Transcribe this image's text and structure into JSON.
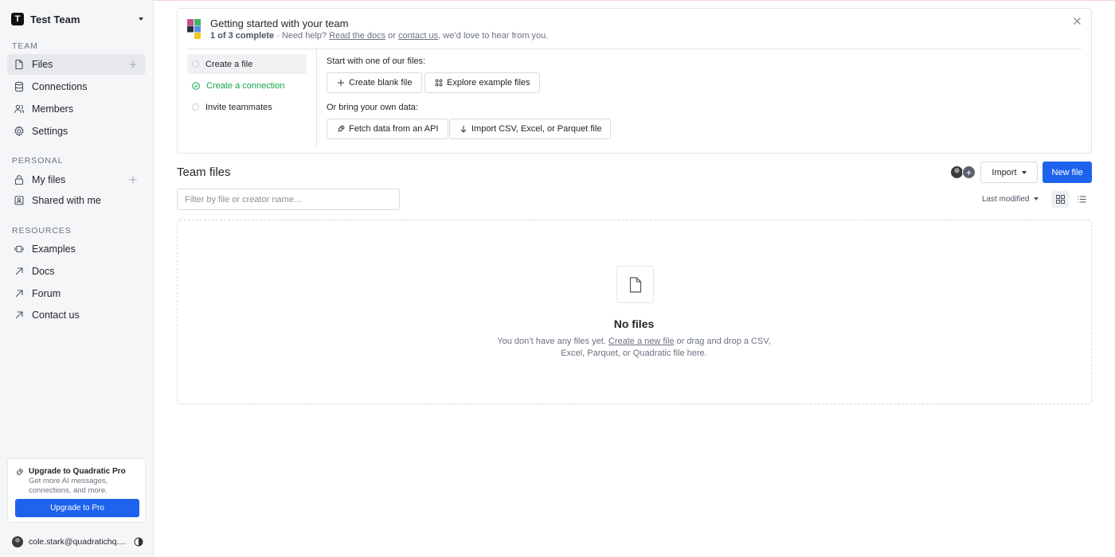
{
  "sidebar": {
    "team_name": "Test Team",
    "team_initial": "T",
    "sections": {
      "team": "TEAM",
      "personal": "PERSONAL",
      "resources": "RESOURCES"
    },
    "team_items": [
      {
        "label": "Files",
        "icon": "file-icon",
        "active": true
      },
      {
        "label": "Connections",
        "icon": "database-icon"
      },
      {
        "label": "Members",
        "icon": "users-icon"
      },
      {
        "label": "Settings",
        "icon": "gear-icon"
      }
    ],
    "personal_items": [
      {
        "label": "My files",
        "icon": "lock-icon"
      },
      {
        "label": "Shared with me",
        "icon": "shared-icon"
      }
    ],
    "resource_items": [
      {
        "label": "Examples",
        "icon": "examples-icon"
      },
      {
        "label": "Docs",
        "icon": "external-arrow-icon"
      },
      {
        "label": "Forum",
        "icon": "external-arrow-icon"
      },
      {
        "label": "Contact us",
        "icon": "external-arrow-icon"
      }
    ],
    "upgrade": {
      "title": "Upgrade to Quadratic Pro",
      "description": "Get more AI messages, connections, and more.",
      "button": "Upgrade to Pro"
    },
    "user_email": "cole.stark@quadratichq...."
  },
  "getting_started": {
    "title": "Getting started with your team",
    "progress": "1 of 3 complete",
    "help_prefix": " · Need help? ",
    "docs_link": "Read the docs",
    "or_text": " or ",
    "contact_link": "contact us",
    "help_suffix": ", we’d love to hear from you.",
    "steps": [
      {
        "label": "Create a file",
        "done": false,
        "active": true
      },
      {
        "label": "Create a connection",
        "done": true,
        "active": false
      },
      {
        "label": "Invite teammates",
        "done": false,
        "active": false
      }
    ],
    "start_heading": "Start with one of our files:",
    "create_blank": "Create blank file",
    "explore_examples": "Explore example files",
    "bring_heading": "Or bring your own data:",
    "fetch_api": "Fetch data from an API",
    "import_file": "Import CSV, Excel, or Parquet file"
  },
  "team_files": {
    "title": "Team files",
    "import_label": "Import",
    "new_file_label": "New file",
    "filter_placeholder": "Filter by file or creator name...",
    "sort_label": "Last modified",
    "empty_title": "No files",
    "empty_prefix": "You don’t have any files yet. ",
    "empty_link": "Create a new file",
    "empty_suffix": " or drag and drop a CSV, Excel, Parquet, or Quadratic file here."
  },
  "colors": {
    "accent": "#1d63ed",
    "success": "#16a34a"
  }
}
